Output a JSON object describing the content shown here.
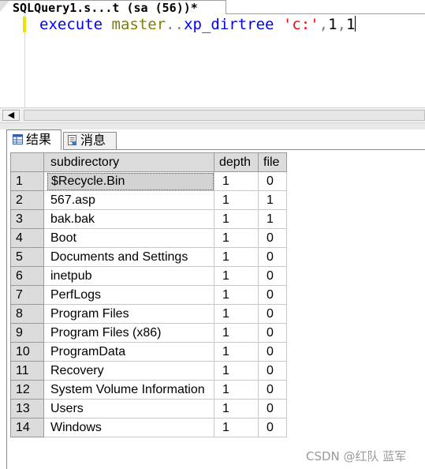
{
  "document_tab": {
    "title": "SQLQuery1.s...t (sa (56))*"
  },
  "editor": {
    "tokens": {
      "keyword": "execute",
      "object": "master",
      "separator": "..",
      "procedure": "xp_dirtree",
      "string_literal": "'c:'",
      "comma1": ",",
      "arg1": "1",
      "comma2": ",",
      "arg2": "1"
    }
  },
  "scrollbar": {
    "left_arrow": "◀"
  },
  "result_tabs": [
    {
      "label": "结果",
      "icon": "grid-icon",
      "active": true
    },
    {
      "label": "消息",
      "icon": "messages-icon",
      "active": false
    }
  ],
  "grid": {
    "columns": [
      "subdirectory",
      "depth",
      "file"
    ],
    "rows": [
      {
        "n": "1",
        "subdirectory": "$Recycle.Bin",
        "depth": "1",
        "file": "0"
      },
      {
        "n": "2",
        "subdirectory": "567.asp",
        "depth": "1",
        "file": "1"
      },
      {
        "n": "3",
        "subdirectory": "bak.bak",
        "depth": "1",
        "file": "1"
      },
      {
        "n": "4",
        "subdirectory": "Boot",
        "depth": "1",
        "file": "0"
      },
      {
        "n": "5",
        "subdirectory": "Documents and Settings",
        "depth": "1",
        "file": "0"
      },
      {
        "n": "6",
        "subdirectory": "inetpub",
        "depth": "1",
        "file": "0"
      },
      {
        "n": "7",
        "subdirectory": "PerfLogs",
        "depth": "1",
        "file": "0"
      },
      {
        "n": "8",
        "subdirectory": "Program Files",
        "depth": "1",
        "file": "0"
      },
      {
        "n": "9",
        "subdirectory": "Program Files (x86)",
        "depth": "1",
        "file": "0"
      },
      {
        "n": "10",
        "subdirectory": "ProgramData",
        "depth": "1",
        "file": "0"
      },
      {
        "n": "11",
        "subdirectory": "Recovery",
        "depth": "1",
        "file": "0"
      },
      {
        "n": "12",
        "subdirectory": "System Volume Information",
        "depth": "1",
        "file": "0"
      },
      {
        "n": "13",
        "subdirectory": "Users",
        "depth": "1",
        "file": "0"
      },
      {
        "n": "14",
        "subdirectory": "Windows",
        "depth": "1",
        "file": "0"
      }
    ]
  },
  "watermark": "CSDN @红队 蓝军",
  "colors": {
    "keyword": "#0000ff",
    "object": "#808000",
    "string": "#ff0000",
    "operator": "#808080",
    "change_bar": "#f2e100",
    "header_bg": "#dcdcdc",
    "selected_cell": "#d3d3d3"
  }
}
